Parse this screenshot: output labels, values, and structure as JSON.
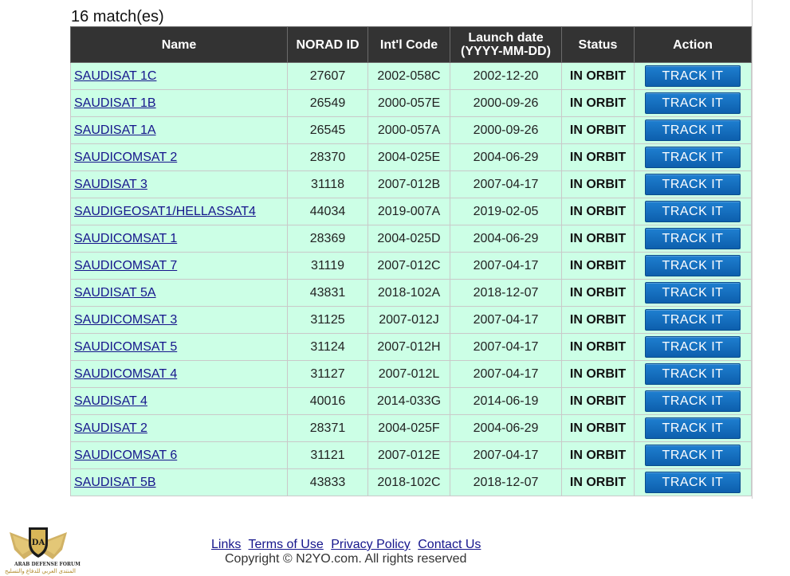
{
  "match_count": "16 match(es)",
  "table": {
    "headers": {
      "name": "Name",
      "norad_id": "NORAD ID",
      "intl_code": "Int'l Code",
      "launch_date_line1": "Launch date",
      "launch_date_line2": "(YYYY-MM-DD)",
      "status": "Status",
      "action": "Action"
    },
    "rows": [
      {
        "name": "SAUDISAT 1C",
        "norad": "27607",
        "intl": "2002-058C",
        "launch": "2002-12-20",
        "status": "IN ORBIT",
        "action": "TRACK IT"
      },
      {
        "name": "SAUDISAT 1B",
        "norad": "26549",
        "intl": "2000-057E",
        "launch": "2000-09-26",
        "status": "IN ORBIT",
        "action": "TRACK IT"
      },
      {
        "name": "SAUDISAT 1A",
        "norad": "26545",
        "intl": "2000-057A",
        "launch": "2000-09-26",
        "status": "IN ORBIT",
        "action": "TRACK IT"
      },
      {
        "name": "SAUDICOMSAT 2",
        "norad": "28370",
        "intl": "2004-025E",
        "launch": "2004-06-29",
        "status": "IN ORBIT",
        "action": "TRACK IT"
      },
      {
        "name": "SAUDISAT 3",
        "norad": "31118",
        "intl": "2007-012B",
        "launch": "2007-04-17",
        "status": "IN ORBIT",
        "action": "TRACK IT"
      },
      {
        "name": "SAUDIGEOSAT1/HELLASSAT4",
        "norad": "44034",
        "intl": "2019-007A",
        "launch": "2019-02-05",
        "status": "IN ORBIT",
        "action": "TRACK IT"
      },
      {
        "name": "SAUDICOMSAT 1",
        "norad": "28369",
        "intl": "2004-025D",
        "launch": "2004-06-29",
        "status": "IN ORBIT",
        "action": "TRACK IT"
      },
      {
        "name": "SAUDICOMSAT 7",
        "norad": "31119",
        "intl": "2007-012C",
        "launch": "2007-04-17",
        "status": "IN ORBIT",
        "action": "TRACK IT"
      },
      {
        "name": "SAUDISAT 5A",
        "norad": "43831",
        "intl": "2018-102A",
        "launch": "2018-12-07",
        "status": "IN ORBIT",
        "action": "TRACK IT"
      },
      {
        "name": "SAUDICOMSAT 3",
        "norad": "31125",
        "intl": "2007-012J",
        "launch": "2007-04-17",
        "status": "IN ORBIT",
        "action": "TRACK IT"
      },
      {
        "name": "SAUDICOMSAT 5",
        "norad": "31124",
        "intl": "2007-012H",
        "launch": "2007-04-17",
        "status": "IN ORBIT",
        "action": "TRACK IT"
      },
      {
        "name": "SAUDICOMSAT 4",
        "norad": "31127",
        "intl": "2007-012L",
        "launch": "2007-04-17",
        "status": "IN ORBIT",
        "action": "TRACK IT"
      },
      {
        "name": "SAUDISAT 4",
        "norad": "40016",
        "intl": "2014-033G",
        "launch": "2014-06-19",
        "status": "IN ORBIT",
        "action": "TRACK IT"
      },
      {
        "name": "SAUDISAT 2",
        "norad": "28371",
        "intl": "2004-025F",
        "launch": "2004-06-29",
        "status": "IN ORBIT",
        "action": "TRACK IT"
      },
      {
        "name": "SAUDICOMSAT 6",
        "norad": "31121",
        "intl": "2007-012E",
        "launch": "2007-04-17",
        "status": "IN ORBIT",
        "action": "TRACK IT"
      },
      {
        "name": "SAUDISAT 5B",
        "norad": "43833",
        "intl": "2018-102C",
        "launch": "2018-12-07",
        "status": "IN ORBIT",
        "action": "TRACK IT"
      }
    ]
  },
  "footer": {
    "links": [
      "Links",
      "Terms of Use",
      "Privacy Policy",
      "Contact Us"
    ],
    "copyright": "Copyright © N2YO.com. All rights reserved"
  },
  "watermark": {
    "monogram": "DA",
    "line1": "ARAB DEFENSE FORUM",
    "line2": "المنتدى العربي للدفاع والتسليح",
    "icon": "winged-shield-logo-icon"
  },
  "colors": {
    "header_bg": "#333333",
    "row_bg": "#ccffe6",
    "button_bg": "#0d5fad",
    "link": "#15158c"
  }
}
